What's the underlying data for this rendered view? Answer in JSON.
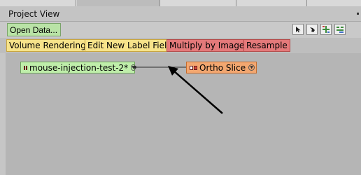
{
  "panel": {
    "title": "Project View"
  },
  "toolbar": {
    "open_data_label": "Open Data..."
  },
  "modules": [
    {
      "label": "Volume Rendering",
      "color": "#f7e38a"
    },
    {
      "label": "Edit New Label Field",
      "color": "#f7e38a"
    },
    {
      "label": "Multiply by Image",
      "color": "#e4797a"
    },
    {
      "label": "Resample",
      "color": "#e4797a"
    }
  ],
  "graph": {
    "data_node": {
      "label": "mouse-injection-test-2*",
      "color": "#bfeeaa"
    },
    "module_node": {
      "label": "Ortho Slice",
      "color": "#f3a770"
    }
  }
}
